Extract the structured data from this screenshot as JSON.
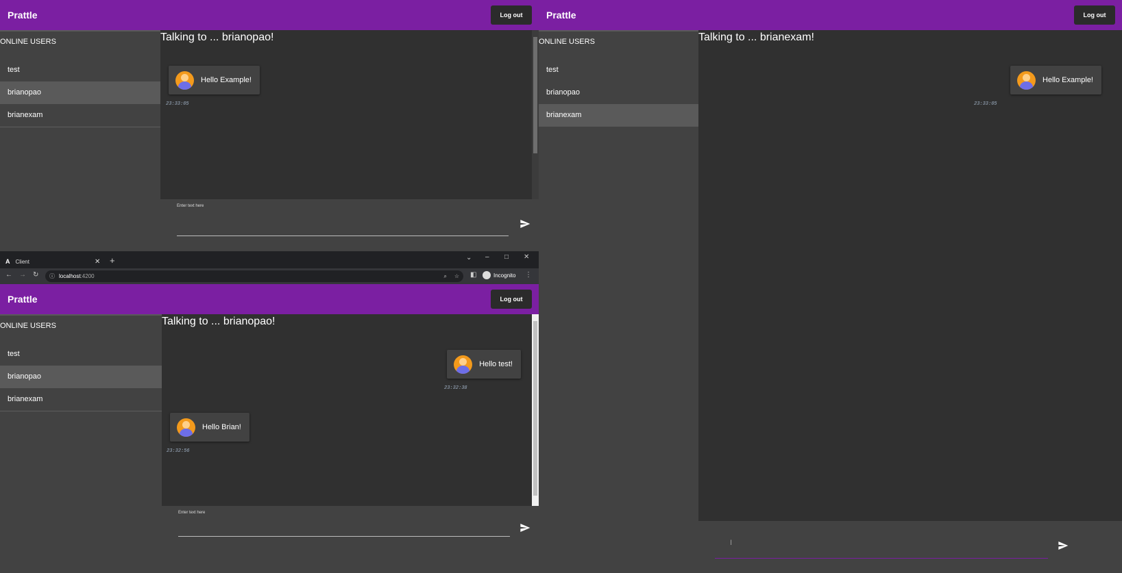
{
  "app_name": "Prattle",
  "logout_label": "Log out",
  "online_users_title": "ONLINE USERS",
  "users": [
    "test",
    "brianopao",
    "brianexam"
  ],
  "input_placeholder": "Enter text here",
  "window_top_left": {
    "active_user_index": 1,
    "talking_to": "Talking to ... brianopao!",
    "messages": [
      {
        "text": "Hello Example!",
        "time": "23:33:05",
        "side": "left"
      }
    ]
  },
  "window_bottom_left": {
    "active_user_index": 1,
    "talking_to": "Talking to ... brianopao!",
    "messages": [
      {
        "text": "Hello test!",
        "time": "23:32:38",
        "side": "right"
      },
      {
        "text": "Hello Brian!",
        "time": "23:32:56",
        "side": "left"
      }
    ]
  },
  "window_right": {
    "active_user_index": 2,
    "talking_to": "Talking to ... brianexam!",
    "messages": [
      {
        "text": "Hello Example!",
        "time": "23:33:05",
        "side": "right"
      }
    ]
  },
  "browser": {
    "tab_title": "Client",
    "url_host": "localhost",
    "url_port": ":4200",
    "profile_label": "Incognito"
  },
  "colors": {
    "toolbar": "#7b1fa2",
    "background": "#303030",
    "sidebar": "#424242",
    "active_item": "#5a5a5a"
  }
}
